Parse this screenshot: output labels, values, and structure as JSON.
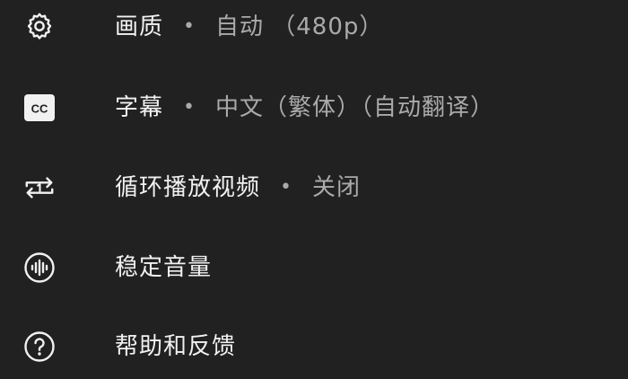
{
  "colors": {
    "background": "#212121",
    "label": "#f1f1f1",
    "value": "#aaaaaa"
  },
  "menu": {
    "items": [
      {
        "icon": "gear-icon",
        "label": "画质",
        "separator": "•",
        "value": "自动 （480p）"
      },
      {
        "icon": "closed-captions-icon",
        "label": "字幕",
        "separator": "•",
        "value": "中文（繁体）（自动翻译）"
      },
      {
        "icon": "repeat-one-icon",
        "label": "循环播放视频",
        "separator": "•",
        "value": "关闭"
      },
      {
        "icon": "stable-volume-icon",
        "label": "稳定音量"
      },
      {
        "icon": "help-circle-icon",
        "label": "帮助和反馈"
      }
    ]
  }
}
